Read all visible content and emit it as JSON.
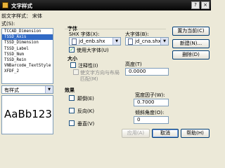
{
  "window": {
    "title": "文字样式",
    "current_style_label": "前文字样式：",
    "current_style_value": "宋体",
    "close_glyph": "×",
    "help_glyph": "?"
  },
  "styles_label": "式(S):",
  "styles": [
    "TCCAD_Dimension",
    "TSSD_Axis",
    "TSSD_Dimension",
    "TSSD_Label",
    "TSSD_Num",
    "TSSD_Rein",
    "VNBarcode_TextStyle",
    "XFDF_2"
  ],
  "selected_style_index": 1,
  "filter_combo": {
    "value": "有样式"
  },
  "preview": {
    "text": "AaBb123"
  },
  "font": {
    "section_label": "字体",
    "shx_label": "SHX 字体(X):",
    "shx_value": "jd_enb.shx",
    "bigfont_label": "大字体(B):",
    "bigfont_value": "jd_cna.shx",
    "use_bigfont_label": "使用大字体(U)",
    "use_bigfont_checked": true
  },
  "size": {
    "section_label": "大小",
    "annotative_label": "注释性(I)",
    "match_orientation_label": "使文字方向与布局",
    "match_orientation_label2": "匹配(M)",
    "height_label": "高度(T)",
    "height_value": "0.0000"
  },
  "effects": {
    "section_label": "效果",
    "upside_down_label": "颠倒(E)",
    "backwards_label": "反向(K)",
    "vertical_label": "垂直(V)",
    "width_factor_label": "宽度因子(W):",
    "width_factor_value": "0.7000",
    "oblique_label": "倾斜角度(O):",
    "oblique_value": "0"
  },
  "buttons": {
    "set_current": "置为当前(C)",
    "new": "新建(N)...",
    "delete": "删除(D)",
    "apply": "应用(A)",
    "cancel": "取消",
    "help": "帮助(H)"
  },
  "colors": {
    "title_bar": "#0a0a0a",
    "selection": "#316ac5",
    "dialog_bg": "#ece9d8"
  }
}
